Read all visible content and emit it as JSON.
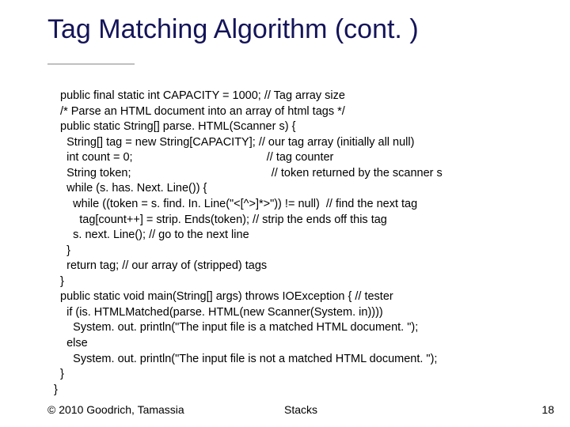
{
  "title": "Tag Matching Algorithm (cont. )",
  "code": "  public final static int CAPACITY = 1000; // Tag array size\n  /* Parse an HTML document into an array of html tags */\n  public static String[] parse. HTML(Scanner s) {\n    String[] tag = new String[CAPACITY]; // our tag array (initially all null)\n    int count = 0;                                          // tag counter\n    String token;                                            // token returned by the scanner s\n    while (s. has. Next. Line()) {\n      while ((token = s. find. In. Line(\"<[^>]*>\")) != null)  // find the next tag\n        tag[count++] = strip. Ends(token); // strip the ends off this tag\n      s. next. Line(); // go to the next line\n    }\n    return tag; // our array of (stripped) tags\n  }\n  public static void main(String[] args) throws IOException { // tester\n    if (is. HTMLMatched(parse. HTML(new Scanner(System. in))))\n      System. out. println(\"The input file is a matched HTML document. \");\n    else\n      System. out. println(\"The input file is not a matched HTML document. \");\n  }\n}",
  "footer": {
    "left": "© 2010 Goodrich, Tamassia",
    "center": "Stacks",
    "right": "18"
  }
}
